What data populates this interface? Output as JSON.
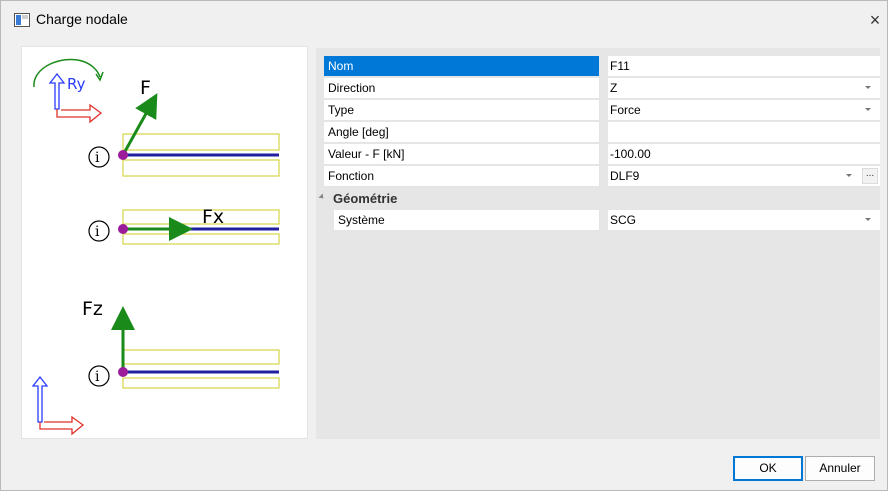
{
  "window": {
    "title": "Charge nodale",
    "close_glyph": "×"
  },
  "diagram": {
    "label_ry": "Ry",
    "label_f": "F",
    "label_fx": "Fx",
    "label_fz": "Fz",
    "node_label": "i",
    "colors": {
      "force_arrow": "#1a8a1a",
      "beam": "#1f1fa0",
      "outline": "#d6d64a",
      "node": "#9b1b9b",
      "axis_blue": "#2a3cff",
      "axis_red": "#e0302a"
    }
  },
  "properties": {
    "rows": [
      {
        "key": "Nom",
        "value": "F11"
      },
      {
        "key": "Direction",
        "value": "Z"
      },
      {
        "key": "Type",
        "value": "Force"
      },
      {
        "key": "Angle [deg]",
        "value": ""
      },
      {
        "key": "Valeur - F [kN]",
        "value": "-100.00"
      },
      {
        "key": "Fonction",
        "value": "DLF9"
      }
    ],
    "ellipsis": "...",
    "category": {
      "label": "Géométrie",
      "rows": [
        {
          "key": "Système",
          "value": "SCG"
        }
      ]
    },
    "selection_color": "#0078d7"
  },
  "buttons": {
    "ok": "OK",
    "cancel": "Annuler"
  }
}
